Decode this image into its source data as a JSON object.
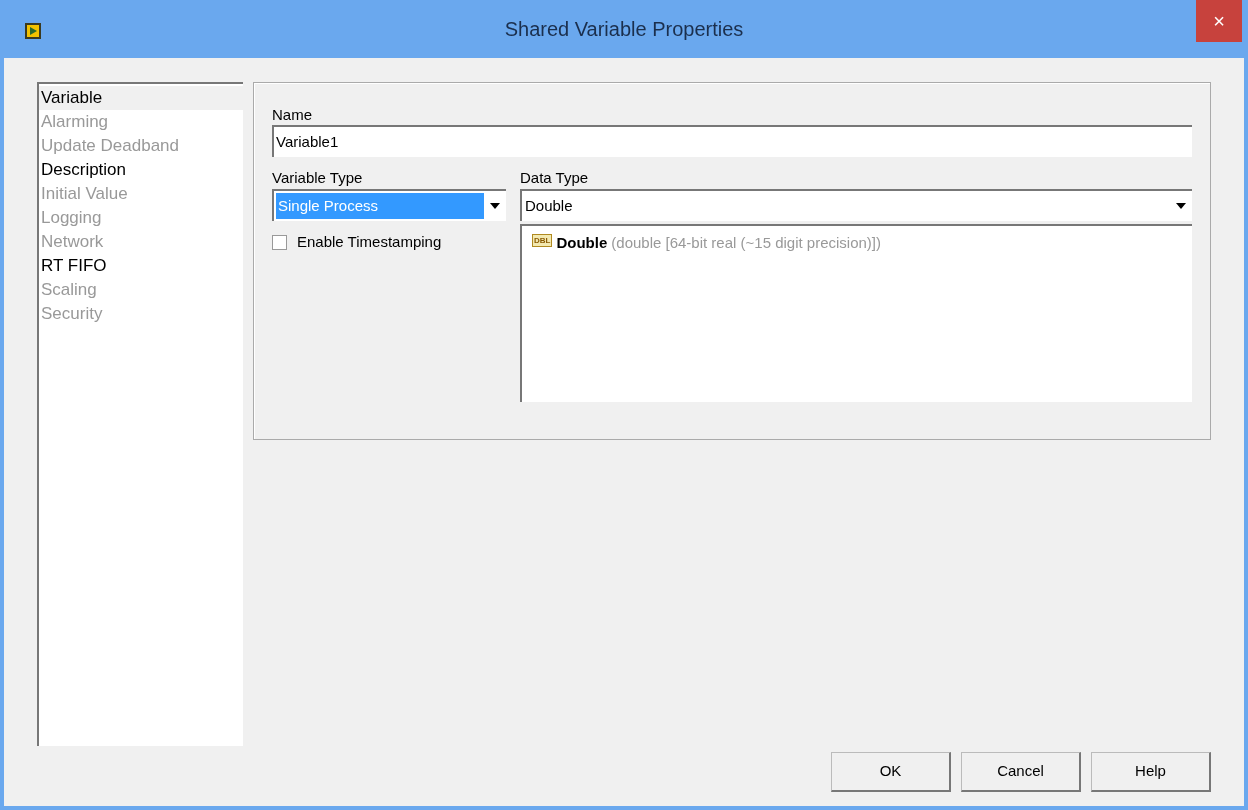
{
  "window": {
    "title": "Shared Variable Properties",
    "close_label": "×"
  },
  "sidebar": {
    "items": [
      {
        "label": "Variable",
        "selected": true,
        "disabled": false
      },
      {
        "label": "Alarming",
        "selected": false,
        "disabled": true
      },
      {
        "label": "Update Deadband",
        "selected": false,
        "disabled": true
      },
      {
        "label": "Description",
        "selected": false,
        "disabled": false
      },
      {
        "label": "Initial Value",
        "selected": false,
        "disabled": true
      },
      {
        "label": "Logging",
        "selected": false,
        "disabled": true
      },
      {
        "label": "Network",
        "selected": false,
        "disabled": true
      },
      {
        "label": "RT FIFO",
        "selected": false,
        "disabled": false
      },
      {
        "label": "Scaling",
        "selected": false,
        "disabled": true
      },
      {
        "label": "Security",
        "selected": false,
        "disabled": true
      }
    ]
  },
  "name_field": {
    "label": "Name",
    "value": "Variable1"
  },
  "variable_type": {
    "label": "Variable Type",
    "value": "Single Process"
  },
  "enable_timestamping": {
    "label": "Enable Timestamping",
    "checked": false
  },
  "data_type": {
    "label": "Data Type",
    "value": "Double",
    "badge": "DBL",
    "type_name": "Double",
    "type_description": "(double [64-bit real (~15 digit precision)])"
  },
  "buttons": [
    "OK",
    "Cancel",
    "Help"
  ]
}
